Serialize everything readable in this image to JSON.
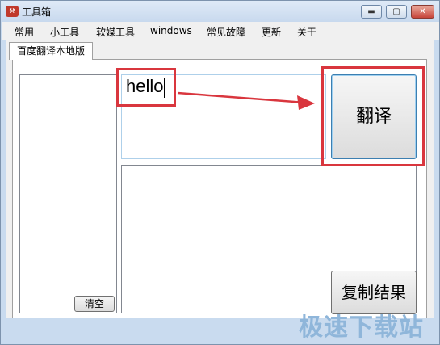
{
  "window": {
    "title": "工具箱",
    "minimize": "▬",
    "maximize": "▢",
    "close": "✕"
  },
  "menu": [
    "常用",
    "小工具",
    "软媒工具",
    "windows",
    "常见故障",
    "更新",
    "关于"
  ],
  "tabs": [
    "百度翻译本地版"
  ],
  "input": {
    "value": "hello"
  },
  "buttons": {
    "translate": "翻译",
    "copy": "复制结果",
    "clear": "清空"
  },
  "watermark": "极速下载站",
  "colors": {
    "annotation_red": "#d9363e",
    "titlebar": "#c8d9ee"
  }
}
